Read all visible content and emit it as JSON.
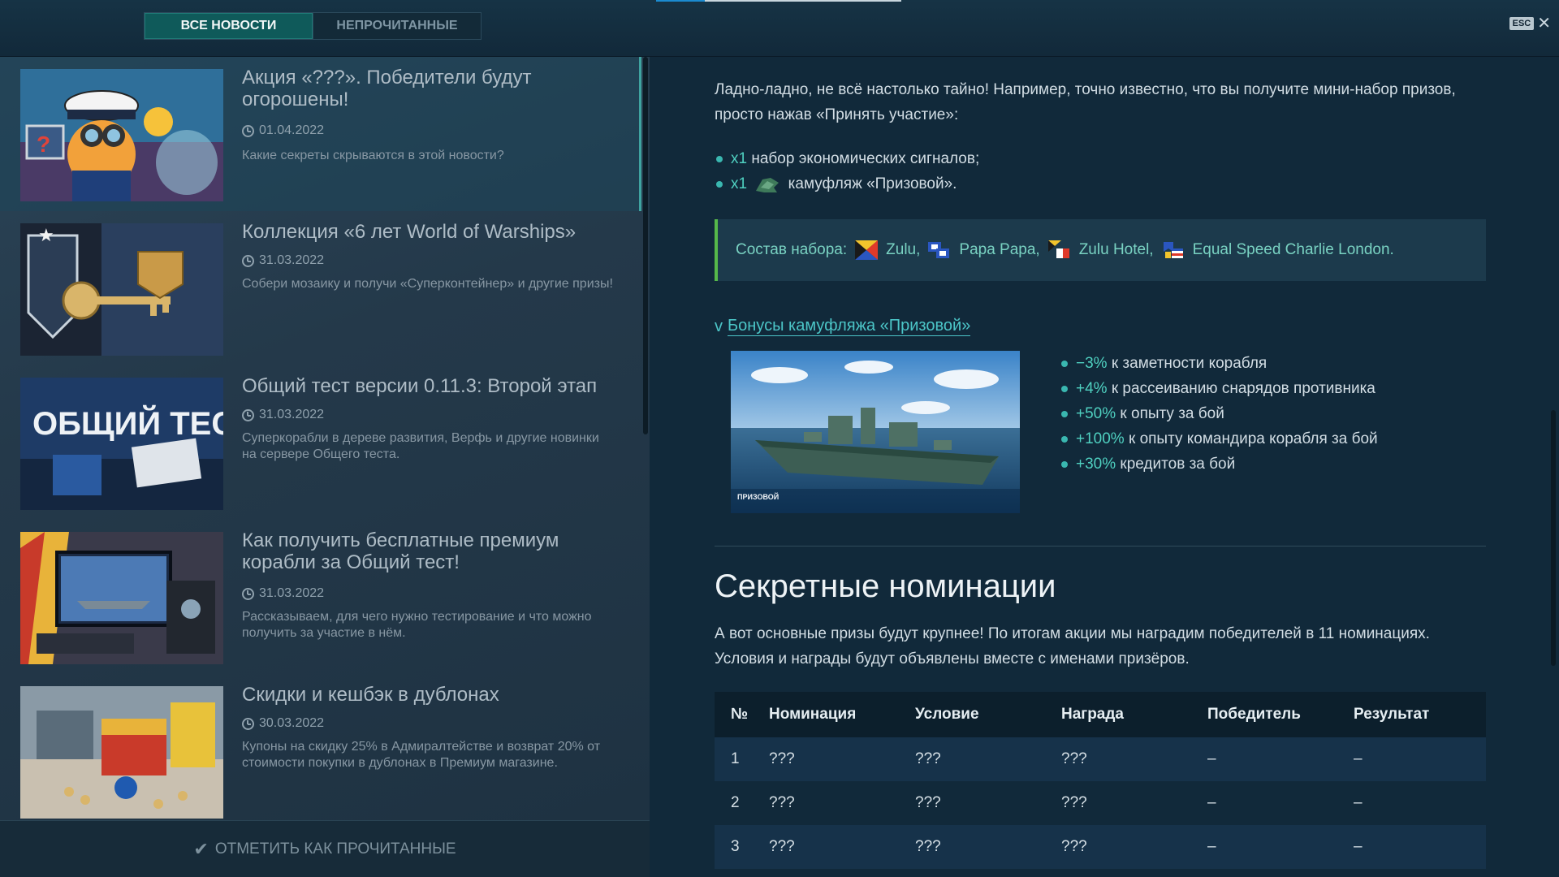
{
  "tabs": {
    "all": "ВСЕ НОВОСТИ",
    "unread": "НЕПРОЧИТАННЫЕ"
  },
  "esc": {
    "key": "ESC",
    "close": "✕"
  },
  "news": [
    {
      "title": "Акция «???». Победители будут огорошены!",
      "date": "01.04.2022",
      "desc": "Какие секреты скрываются в этой новости?"
    },
    {
      "title": "Коллекция «6 лет World of Warships»",
      "date": "31.03.2022",
      "desc": "Собери мозаику и получи «Суперконтейнер» и другие призы!"
    },
    {
      "title": "Общий тест версии 0.11.3: Второй этап",
      "date": "31.03.2022",
      "desc": "Суперкорабли в дереве развития, Верфь и другие новинки на сервере Общего теста.",
      "thumb_text": "ОБЩИЙ ТЕСТ"
    },
    {
      "title": "Как получить бесплатные премиум корабли за Общий тест!",
      "date": "31.03.2022",
      "desc": "Рассказываем, для чего нужно тестирование и что можно получить за участие в нём."
    },
    {
      "title": "Скидки и кешбэк в дублонах",
      "date": "30.03.2022",
      "desc": "Купоны на скидку 25% в Адмиралтействе и возврат 20% от стоимости покупки в дублонах в Премиум магазине."
    }
  ],
  "mark_read": "ОТМЕТИТЬ КАК ПРОЧИТАННЫЕ",
  "article": {
    "intro": "Ладно-ладно, не всё настолько тайно! Например, точно известно, что вы получите мини-набор призов, просто нажав «Принять участие»:",
    "rewards": [
      {
        "qty": "x1",
        "text": "набор экономических сигналов;"
      },
      {
        "qty": "x1",
        "text": "камуфляж «Призовой»."
      }
    ],
    "kit_label": "Состав набора:",
    "kit_items": [
      "Zulu,",
      "Papa Papa,",
      "Zulu Hotel,",
      "Equal Speed Charlie London."
    ],
    "bonus_head": "Бонусы камуфляжа «Призовой»",
    "bonus_chevron": "v",
    "ship_caption": "ПРИЗОВОЙ",
    "bonuses": [
      {
        "value": "−3%",
        "text": "к заметности корабля"
      },
      {
        "value": "+4%",
        "text": "к рассеиванию снарядов противника"
      },
      {
        "value": "+50%",
        "text": "к опыту за бой"
      },
      {
        "value": "+100%",
        "text": "к опыту командира корабля за бой"
      },
      {
        "value": "+30%",
        "text": "кредитов за бой"
      }
    ],
    "section_title": "Секретные номинации",
    "section_text": "А вот основные призы будут крупнее! По итогам акции мы наградим победителей в 11 номинациях. Условия и награды будут объявлены вместе с именами призёров.",
    "table": {
      "headers": [
        "№",
        "Номинация",
        "Условие",
        "Награда",
        "Победитель",
        "Результат"
      ],
      "rows": [
        [
          "1",
          "???",
          "???",
          "???",
          "–",
          "–"
        ],
        [
          "2",
          "???",
          "???",
          "???",
          "–",
          "–"
        ],
        [
          "3",
          "???",
          "???",
          "???",
          "–",
          "–"
        ]
      ]
    }
  },
  "colors": {
    "accent": "#4fd0c0",
    "tab_active": "#0f5a5a",
    "kit_border": "#56b84a"
  },
  "progress": {
    "top_loading_fraction": 0.2
  }
}
